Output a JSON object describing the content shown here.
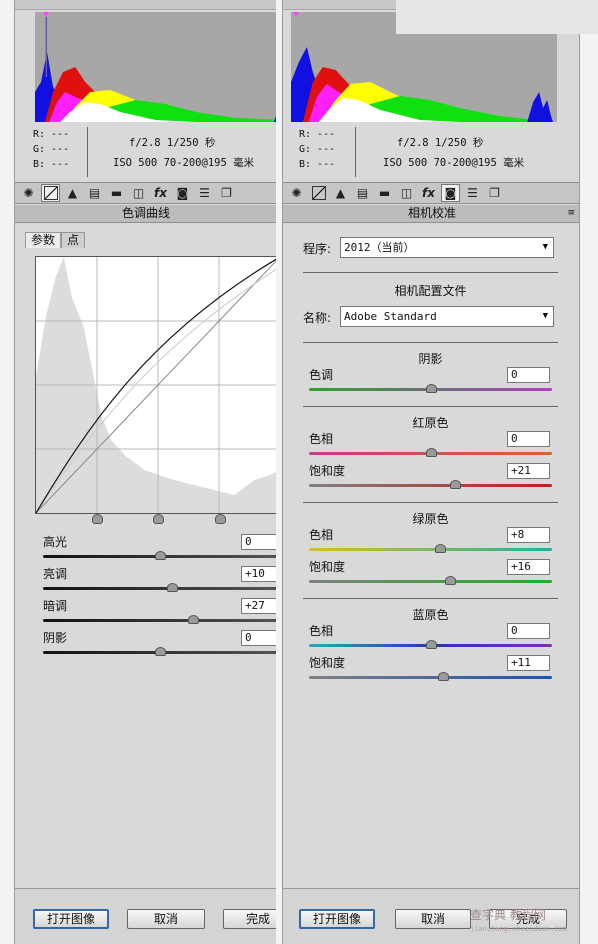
{
  "left": {
    "readout": {
      "r": "R:  ---",
      "g": "G:  ---",
      "b": "B:  ---",
      "exposure": "f/2.8  1/250 秒",
      "iso_lens": "ISO 500   70-200@195 毫米"
    },
    "panel_title": "色调曲线",
    "subtabs": [
      "参数",
      "点"
    ],
    "sliders": [
      {
        "label": "高光",
        "value": "0",
        "position": 0.5
      },
      {
        "label": "亮调",
        "value": "+10",
        "position": 0.55
      },
      {
        "label": "暗调",
        "value": "+27",
        "position": 0.64
      },
      {
        "label": "阴影",
        "value": "0",
        "position": 0.5
      }
    ],
    "split_handles": [
      0.25,
      0.5,
      0.75
    ],
    "buttons": {
      "open": "打开图像",
      "cancel": "取消",
      "done": "完成"
    }
  },
  "right": {
    "readout": {
      "r": "R:  ---",
      "g": "G:  ---",
      "b": "B:  ---",
      "exposure": "f/2.8  1/250 秒",
      "iso_lens": "ISO 500   70-200@195 毫米"
    },
    "panel_title": "相机校准",
    "process_label": "程序:",
    "process_value": "2012（当前）",
    "profile_heading": "相机配置文件",
    "name_label": "名称:",
    "name_value": "Adobe Standard",
    "groups": [
      {
        "title": "阴影",
        "sliders": [
          {
            "label": "色调",
            "value": "0",
            "position": 0.5,
            "track": "linear-gradient(90deg,#2ea02e,#b040c0)"
          }
        ]
      },
      {
        "title": "红原色",
        "sliders": [
          {
            "label": "色相",
            "value": "0",
            "position": 0.5,
            "track": "linear-gradient(90deg,#c83a8a,#d06a20)"
          },
          {
            "label": "饱和度",
            "value": "+21",
            "position": 0.6,
            "track": "linear-gradient(90deg,#808080,#c02020)"
          }
        ]
      },
      {
        "title": "绿原色",
        "sliders": [
          {
            "label": "色相",
            "value": "+8",
            "position": 0.54,
            "track": "linear-gradient(90deg,#d8c020,#20b0a0)"
          },
          {
            "label": "饱和度",
            "value": "+16",
            "position": 0.58,
            "track": "linear-gradient(90deg,#808080,#20b020)"
          }
        ]
      },
      {
        "title": "蓝原色",
        "sliders": [
          {
            "label": "色相",
            "value": "0",
            "position": 0.5,
            "track": "linear-gradient(90deg,#20b0b0,#3030c0,#8030b0)"
          },
          {
            "label": "饱和度",
            "value": "+11",
            "position": 0.55,
            "track": "linear-gradient(90deg,#808080,#2050b0)"
          }
        ]
      }
    ],
    "buttons": {
      "open": "打开图像",
      "cancel": "取消",
      "done": "完成"
    }
  },
  "watermark": {
    "main": "查字典 教程网",
    "sub": "jiaocheng.chazidian.com"
  }
}
